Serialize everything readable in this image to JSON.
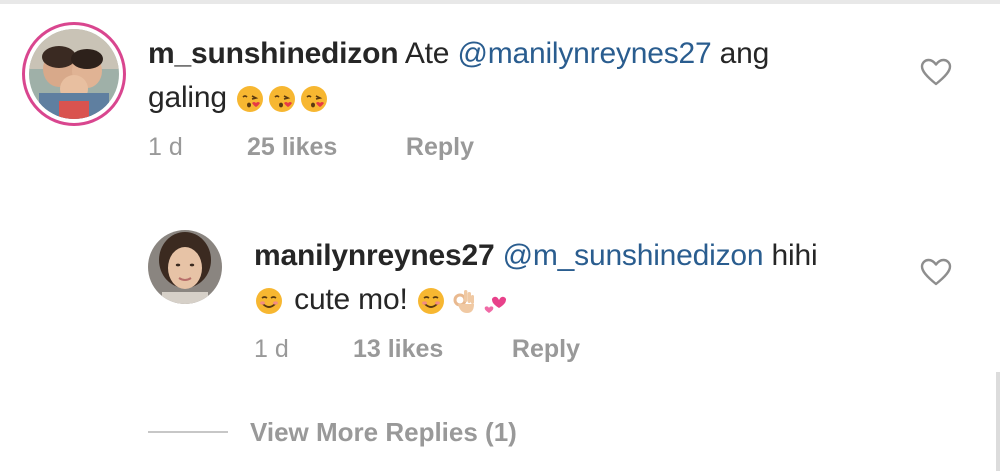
{
  "comments": [
    {
      "username": "m_sunshinedizon",
      "text_pre": "Ate",
      "mention": "@manilynreynes27",
      "text_post": "ang",
      "text_line2": "galing",
      "emojis": [
        "face-blowing-kiss-emoji",
        "face-blowing-kiss-emoji",
        "face-blowing-kiss-emoji"
      ],
      "time": "1 d",
      "likes": "25 likes",
      "reply_label": "Reply",
      "avatar": "profile-photo-group"
    },
    {
      "username": "manilynreynes27",
      "mention": "@m_sunshinedizon",
      "text_post": "hihi",
      "text_line2": "cute mo!",
      "emojis_before": [
        "smiling-face-emoji"
      ],
      "emojis_after": [
        "smiling-face-emoji",
        "ok-hand-emoji",
        "two-hearts-emoji"
      ],
      "time": "1 d",
      "likes": "13 likes",
      "reply_label": "Reply",
      "avatar": "profile-photo-woman"
    }
  ],
  "view_more": {
    "label": "View More Replies (1)"
  },
  "icons": {
    "like": "heart-outline-icon"
  },
  "colors": {
    "text": "#262626",
    "secondary": "#999999",
    "mention": "#2a5d8f",
    "story_ring": "#d9468f",
    "divider": "#c7c7c7"
  }
}
